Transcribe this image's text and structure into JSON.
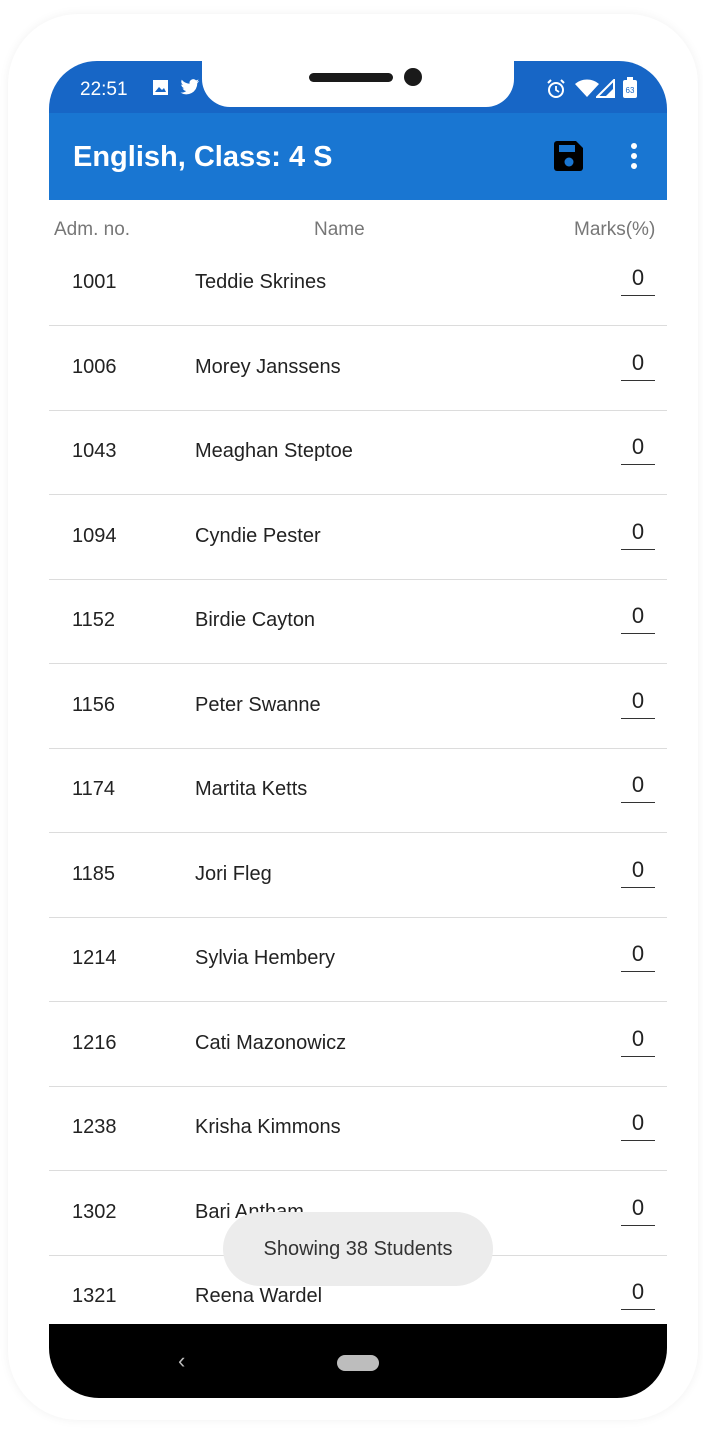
{
  "status_bar": {
    "time": "22:51",
    "left_icons": [
      "image-icon",
      "twitter-icon"
    ],
    "right_icons": [
      "alarm-icon",
      "wifi-icon",
      "signal-icon",
      "battery-icon"
    ],
    "battery": "63"
  },
  "app_bar": {
    "title": "English, Class: 4 S",
    "actions": [
      "save-icon",
      "more-vert-icon"
    ]
  },
  "columns": {
    "adm": "Adm. no.",
    "name": "Name",
    "marks": "Marks(%)"
  },
  "students": [
    {
      "adm": "1001",
      "name": "Teddie Skrines",
      "marks": "0"
    },
    {
      "adm": "1006",
      "name": "Morey Janssens",
      "marks": "0"
    },
    {
      "adm": "1043",
      "name": "Meaghan Steptoe",
      "marks": "0"
    },
    {
      "adm": "1094",
      "name": "Cyndie Pester",
      "marks": "0"
    },
    {
      "adm": "1152",
      "name": "Birdie Cayton",
      "marks": "0"
    },
    {
      "adm": "1156",
      "name": "Peter Swanne",
      "marks": "0"
    },
    {
      "adm": "1174",
      "name": "Martita Ketts",
      "marks": "0"
    },
    {
      "adm": "1185",
      "name": "Jori Fleg",
      "marks": "0"
    },
    {
      "adm": "1214",
      "name": "Sylvia Hembery",
      "marks": "0"
    },
    {
      "adm": "1216",
      "name": "Cati Mazonowicz",
      "marks": "0"
    },
    {
      "adm": "1238",
      "name": "Krisha Kimmons",
      "marks": "0"
    },
    {
      "adm": "1302",
      "name": "Bari Antham",
      "marks": "0"
    },
    {
      "adm": "1321",
      "name": "Reena Wardel",
      "marks": "0"
    }
  ],
  "toast": "Showing 38 Students",
  "nav_bar": {
    "back_glyph": "‹",
    "buttons": [
      "back-icon",
      "home-pill"
    ]
  },
  "colors": {
    "app_bar": "#1976d2",
    "status_bar": "#1766c6",
    "nav_bar": "#000000"
  }
}
